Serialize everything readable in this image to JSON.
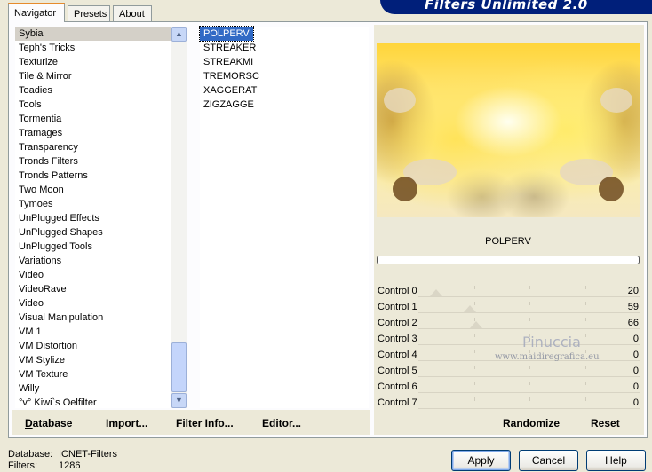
{
  "tabs": [
    "Navigator",
    "Presets",
    "About"
  ],
  "banner_title": "Filters Unlimited 2.0",
  "categories": [
    "Sybia",
    "Teph's Tricks",
    "Texturize",
    "Tile & Mirror",
    "Toadies",
    "Tools",
    "Tormentia",
    "Tramages",
    "Transparency",
    "Tronds Filters",
    "Tronds Patterns",
    "Two Moon",
    "Tymoes",
    "UnPlugged Effects",
    "UnPlugged Shapes",
    "UnPlugged Tools",
    "Variations",
    "Video",
    "VideoRave",
    "Video",
    "Visual Manipulation",
    "VM 1",
    "VM Distortion",
    "VM Stylize",
    "VM Texture",
    "Willy",
    "°v° Kiwi`s Oelfilter"
  ],
  "selected_category": "Sybia",
  "filters": [
    "POLPERV",
    "STREAKER",
    "STREAKMI",
    "TREMORSC",
    "XAGGERAT",
    "ZIGZAGGE"
  ],
  "selected_filter": "POLPERV",
  "left_buttons": {
    "database": "Database",
    "import": "Import...",
    "filter_info": "Filter Info...",
    "editor": "Editor..."
  },
  "preview_caption": "POLPERV",
  "controls": [
    {
      "label": "Control 0",
      "value": "20"
    },
    {
      "label": "Control 1",
      "value": "59"
    },
    {
      "label": "Control 2",
      "value": "66"
    },
    {
      "label": "Control 3",
      "value": "0"
    },
    {
      "label": "Control 4",
      "value": "0"
    },
    {
      "label": "Control 5",
      "value": "0"
    },
    {
      "label": "Control 6",
      "value": "0"
    },
    {
      "label": "Control 7",
      "value": "0"
    }
  ],
  "right_buttons": {
    "randomize": "Randomize",
    "reset": "Reset"
  },
  "watermark": {
    "name": "Pinuccia",
    "url": "www.maidiregrafica.eu"
  },
  "status": {
    "database_label": "Database:",
    "database_value": "ICNET-Filters",
    "filters_label": "Filters:",
    "filters_value": "1286"
  },
  "dialog_buttons": {
    "apply": "Apply",
    "cancel": "Cancel",
    "help": "Help"
  },
  "colors": {
    "selection": "#316AC5",
    "banner": "#001F7A",
    "face": "#ECE9D8"
  }
}
